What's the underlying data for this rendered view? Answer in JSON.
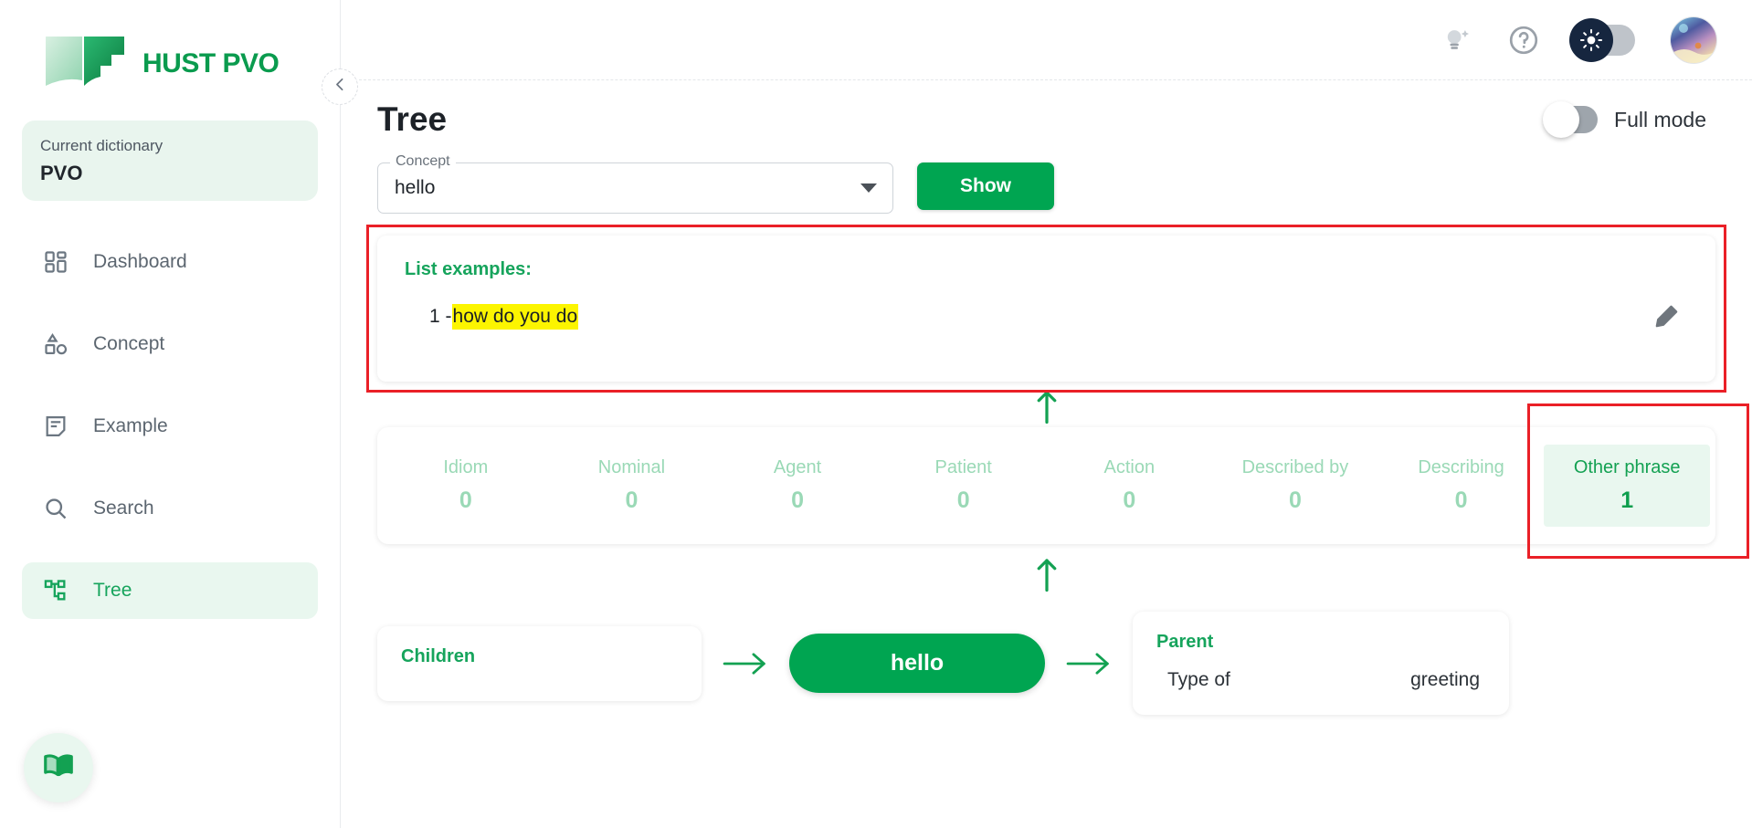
{
  "brand": {
    "name": "HUST PVO",
    "logo_icon": "open-book-icon",
    "accent_green": "#00a551",
    "accent_green_light": "#e9f7ef"
  },
  "sidebar": {
    "dictionary_label": "Current dictionary",
    "dictionary_value": "PVO",
    "collapse_icon": "chevron-left-icon",
    "fab_icon": "book-icon",
    "items": [
      {
        "label": "Dashboard",
        "icon": "dashboard-grid-icon",
        "active": false
      },
      {
        "label": "Concept",
        "icon": "shapes-icon",
        "active": false
      },
      {
        "label": "Example",
        "icon": "note-document-icon",
        "active": false
      },
      {
        "label": "Search",
        "icon": "magnifier-icon",
        "active": false
      },
      {
        "label": "Tree",
        "icon": "tree-hierarchy-icon",
        "active": true
      }
    ]
  },
  "topbar": {
    "idea_icon": "lightbulb-sparkle-icon",
    "help_icon": "question-circle-icon",
    "theme_icon": "sun-icon",
    "theme_toggle_on": true,
    "avatar_icon": "user-avatar-image"
  },
  "page": {
    "title": "Tree",
    "full_mode_label": "Full mode",
    "full_mode_on": false
  },
  "concept_select": {
    "legend": "Concept",
    "value": "hello",
    "placeholder": "Select concept",
    "dropdown_icon": "chevron-down-icon"
  },
  "show_button": {
    "label": "Show"
  },
  "examples": {
    "title": "List examples:",
    "edit_icon": "pencil-icon",
    "highlighted": true,
    "items": [
      {
        "index": "1 - ",
        "text": "how do you do",
        "highlight_color": "#fcf500"
      }
    ]
  },
  "stats": {
    "highlight_index": 7,
    "items": [
      {
        "label": "Idiom",
        "value": "0"
      },
      {
        "label": "Nominal",
        "value": "0"
      },
      {
        "label": "Agent",
        "value": "0"
      },
      {
        "label": "Patient",
        "value": "0"
      },
      {
        "label": "Action",
        "value": "0"
      },
      {
        "label": "Described by",
        "value": "0"
      },
      {
        "label": "Describing",
        "value": "0"
      },
      {
        "label": "Other phrase",
        "value": "1"
      }
    ]
  },
  "tree": {
    "children_title": "Children",
    "node_label": "hello",
    "parent_title": "Parent",
    "parent_relation_key": "Type of",
    "parent_relation_value": "greeting",
    "arrow_icon": "arrow-right-icon",
    "up_arrow_icon": "arrow-up-icon"
  }
}
